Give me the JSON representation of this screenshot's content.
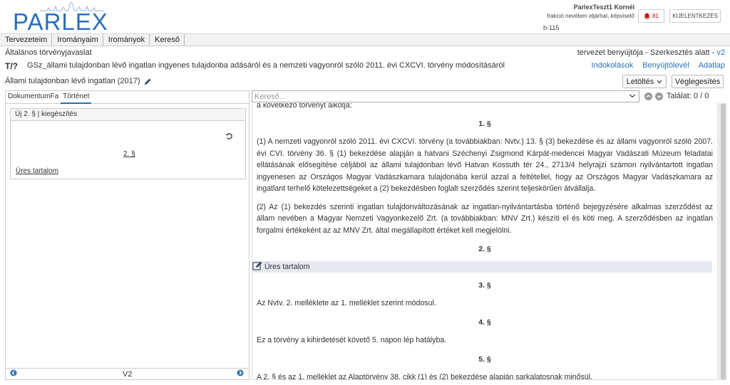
{
  "app": {
    "logo_text": "PARLEX"
  },
  "user": {
    "name": "ParlexTeszt1 Kornél",
    "role": "frakció nevében eljárhat, képviselő",
    "code": "b-115",
    "notifications": "81",
    "logout_label": "KIJELENTKEZÉS"
  },
  "menu": [
    {
      "label": "Tervezeteim"
    },
    {
      "label": "Irományaim"
    },
    {
      "label": "Irományok"
    },
    {
      "label": "Kereső"
    }
  ],
  "document": {
    "type": "Általános törvényjavaslat",
    "status_prefix": "tervezet benyújtója - Szerkesztés alatt - ",
    "version": "v2",
    "code": "T/?",
    "title": "GSz_állami tulajdonban lévő ingatlan ingyenes tulajdonba adásáról és a nemzeti vagyonról szóló 2011. évi CXCVI. törvény módosításáról",
    "links": [
      "Indokolások",
      "Benyújtólevél",
      "Adatlap"
    ],
    "subtitle": "Állami tulajdonban lévő ingatlan (2017)",
    "download_label": "Letöltés",
    "finalize_label": "Véglegesítés"
  },
  "left_panel": {
    "tabs": [
      "DokumentumFa",
      "Történet"
    ],
    "card_title": "Új 2. § | kiegészítés",
    "card_para": "2. §",
    "card_empty": "Üres tartalom",
    "footer_version": "V2"
  },
  "search": {
    "placeholder": "Kereső...",
    "hits": "Találat: 0 / 0"
  },
  "content": {
    "intro": "a következő törvényt alkotja:",
    "s1_head": "1. §",
    "s1_p1": "(1) A nemzeti vagyonról szóló 2011. évi CXCVI. törvény (a továbbiakban: Nvtv.) 13. § (3) bekezdése és az állami vagyonról szóló 2007. évi CVI. törvény 36. § (1) bekezdése alapján a hatvani Széchenyi Zsigmond Kárpát-medencei Magyar Vadászati Múzeum feladatai ellátásának elősegítése céljából az állami tulajdonban lévő Hatvan Kossuth tér 24., 2713/4 helyrajzi számon nyilvántartott ingatlan ingyenesen az Országos Magyar Vadászkamara tulajdonába kerül azzal a feltétellel, hogy az Országos Magyar Vadászkamara az ingatlant terhelő kötelezettségeket a (2) bekezdésben foglalt szerződés szerint teljeskörűen átvállalja.",
    "s1_p2": "(2) Az (1) bekezdés szerinti ingatlan tulajdonváltozásának az ingatlan-nyilvántartásba történő bejegyzésére alkalmas szerződést az állam nevében a Magyar Nemzeti Vagyonkezelő Zrt. (a továbbiakban: MNV Zrt.) készíti el és köti meg. A szerződésben az ingatlan forgalmi értékeként az az MNV Zrt. által megállapított értéket kell megjelölni.",
    "s2_head": "2. §",
    "s2_empty": "Üres tartalom",
    "s3_head": "3. §",
    "s3_p": "Az Nvtv. 2. melléklete az 1. melléklet szerint módosul.",
    "s4_head": "4. §",
    "s4_p": "Ez a törvény a kihirdetését követő 5. napon lép hatályba.",
    "s5_head": "5. §",
    "s5_p": "A 2. § és az 1. melléklet az Alaptörvény 38. cikk (1) és (2) bekezdése alapján sarkalatosnak minősül."
  }
}
